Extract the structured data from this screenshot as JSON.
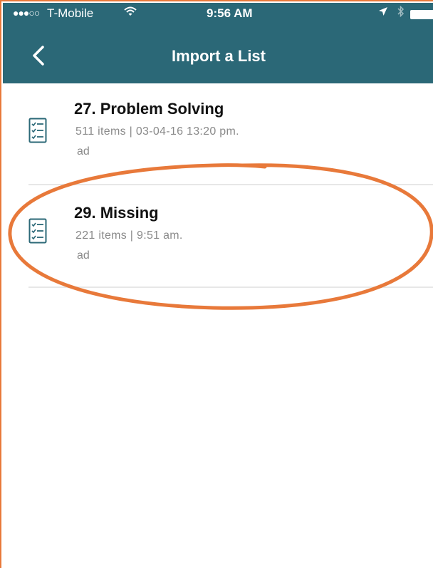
{
  "status_bar": {
    "signal": "●●●○○",
    "carrier": "T-Mobile",
    "time": "9:56 AM"
  },
  "nav": {
    "title": "Import a List"
  },
  "lists": [
    {
      "title": "27. Problem Solving",
      "meta": "511 items  |  03-04-16 13:20 pm.",
      "subtitle": "ad"
    },
    {
      "title": "29. Missing",
      "meta": "221 items  |  9:51 am.",
      "subtitle": "ad"
    }
  ],
  "colors": {
    "header": "#2b6877",
    "annotation": "#e8793a",
    "icon": "#2b6877"
  }
}
